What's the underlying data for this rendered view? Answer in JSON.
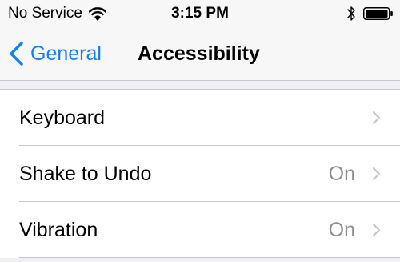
{
  "status_bar": {
    "carrier": "No Service",
    "time": "3:15 PM",
    "icons": [
      "wifi-icon",
      "bluetooth-icon",
      "battery-icon"
    ]
  },
  "nav": {
    "back_label": "General",
    "title": "Accessibility",
    "back_icon": "chevron-left-icon",
    "accent_color": "#157efb"
  },
  "rows": [
    {
      "label": "Keyboard",
      "value": ""
    },
    {
      "label": "Shake to Undo",
      "value": "On"
    },
    {
      "label": "Vibration",
      "value": "On"
    }
  ],
  "colors": {
    "background": "#efeff4",
    "bar": "#f7f7f8",
    "separator": "#c8c7cc",
    "secondary_text": "#8e8e93",
    "chevron": "#c7c7cc"
  }
}
